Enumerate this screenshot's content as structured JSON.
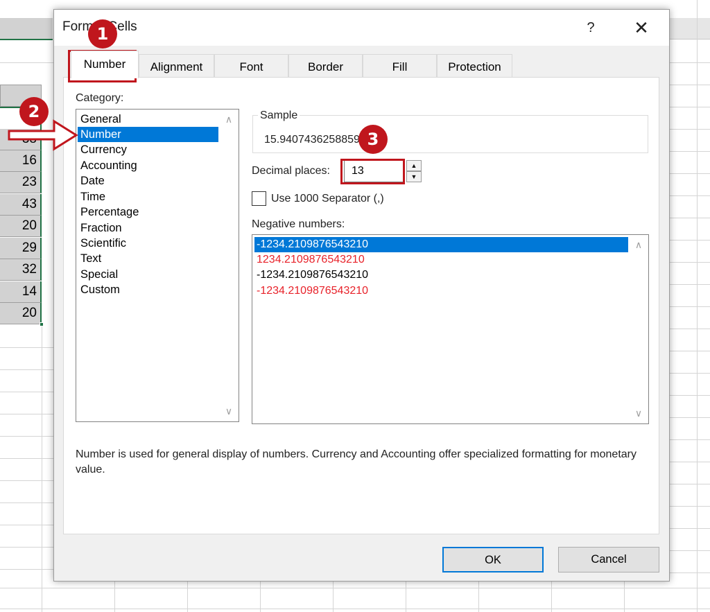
{
  "sheet": {
    "values": [
      "38",
      "16",
      "23",
      "43",
      "20",
      "29",
      "32",
      "14",
      "20"
    ]
  },
  "dialog": {
    "title": "Format Cells",
    "help_icon": "?",
    "close_icon": "✕",
    "tabs": [
      {
        "label": "Number",
        "active": true
      },
      {
        "label": "Alignment",
        "active": false
      },
      {
        "label": "Font",
        "active": false
      },
      {
        "label": "Border",
        "active": false
      },
      {
        "label": "Fill",
        "active": false
      },
      {
        "label": "Protection",
        "active": false
      }
    ],
    "category_label": "Category:",
    "categories": [
      "General",
      "Number",
      "Currency",
      "Accounting",
      "Date",
      "Time",
      "Percentage",
      "Fraction",
      "Scientific",
      "Text",
      "Special",
      "Custom"
    ],
    "selected_category": "Number",
    "sample_label": "Sample",
    "sample_value": "15.9407436258859",
    "decimal_places_label": "Decimal places:",
    "decimal_places_value": "13",
    "separator_label": "Use 1000 Separator (,)",
    "separator_checked": false,
    "negative_label": "Negative numbers:",
    "negative_formats": [
      {
        "text": "-1234.2109876543210",
        "style": "selected"
      },
      {
        "text": "1234.2109876543210",
        "style": "red"
      },
      {
        "text": "-1234.2109876543210",
        "style": "normal"
      },
      {
        "text": "-1234.2109876543210",
        "style": "red"
      }
    ],
    "description": "Number is used for general display of numbers.  Currency and Accounting offer specialized formatting for monetary value.",
    "ok_label": "OK",
    "cancel_label": "Cancel"
  },
  "annotations": {
    "badges": [
      "1",
      "2",
      "3"
    ],
    "color": "#c0161d"
  },
  "colors": {
    "selection_blue": "#0078d7",
    "excel_green": "#217346",
    "negative_red": "#e8222a"
  }
}
